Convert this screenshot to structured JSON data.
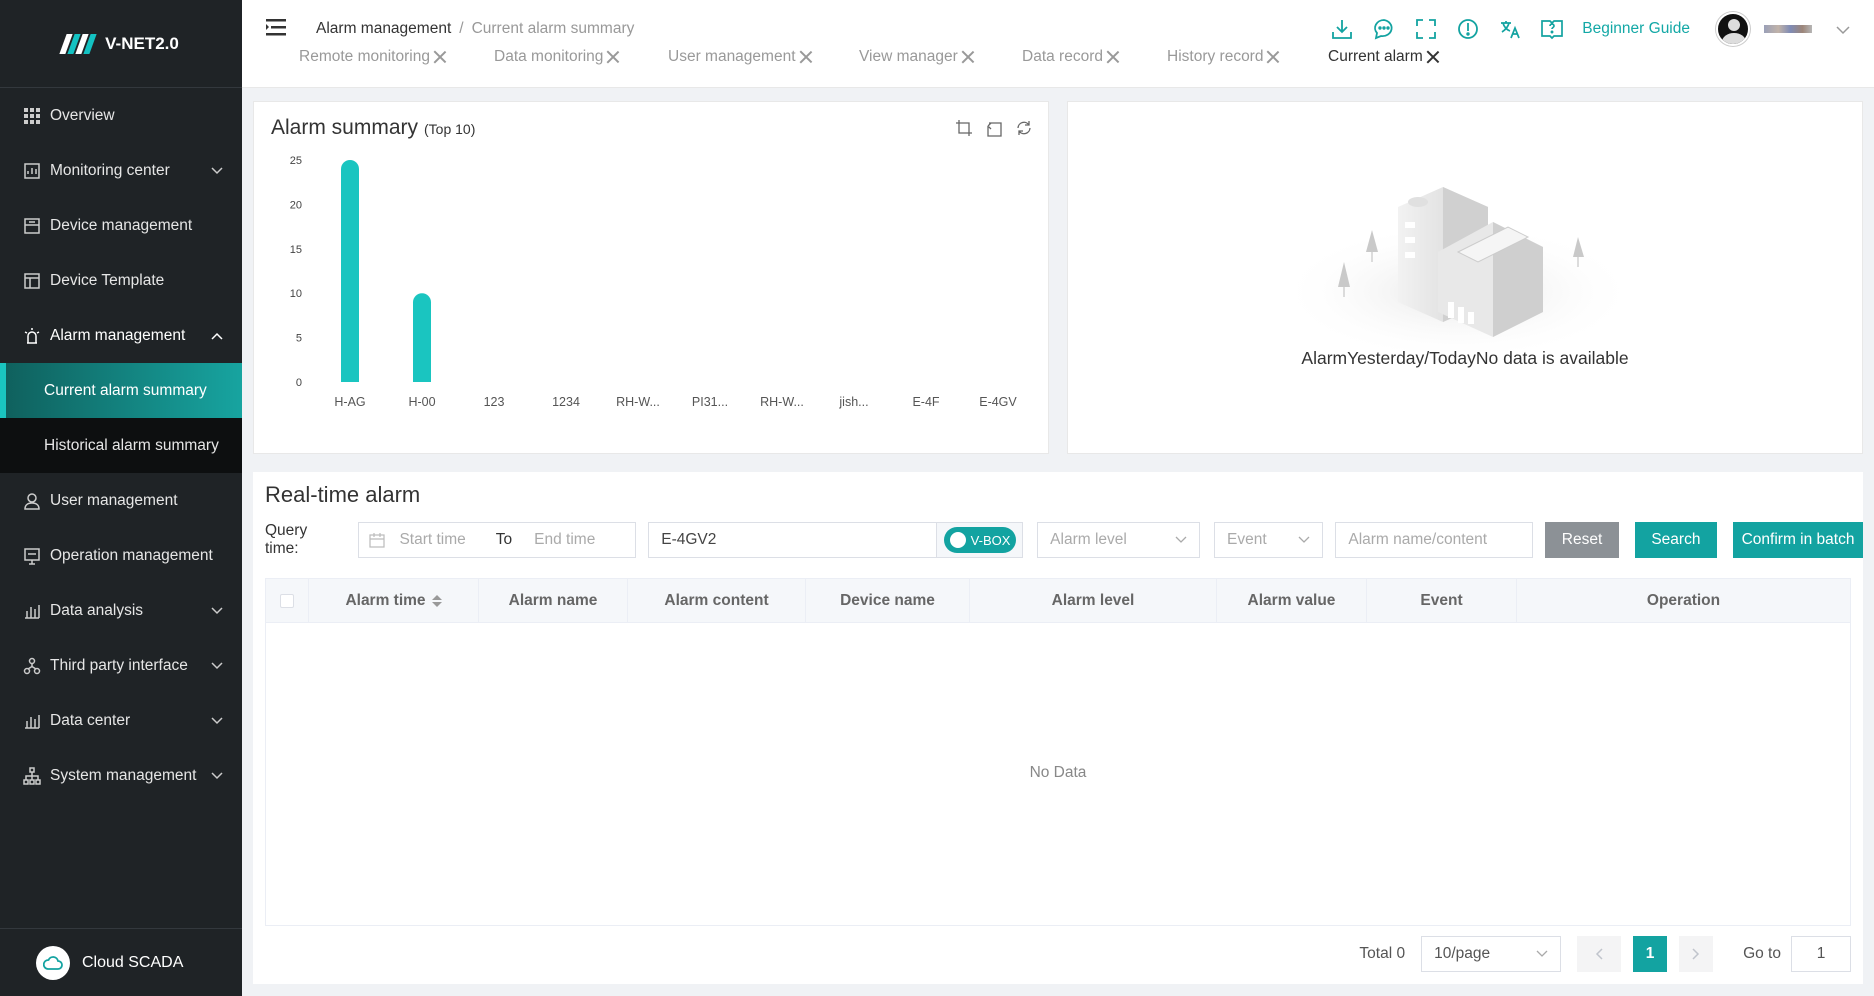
{
  "app": {
    "name": "V-NET2.0",
    "cloud_label": "Cloud SCADA"
  },
  "sidebar": {
    "items": [
      {
        "label": "Overview",
        "icon": "grid-icon",
        "has_chevron": false
      },
      {
        "label": "Monitoring center",
        "icon": "monitor-icon",
        "has_chevron": true
      },
      {
        "label": "Device management",
        "icon": "device-icon",
        "has_chevron": false
      },
      {
        "label": "Device Template",
        "icon": "template-icon",
        "has_chevron": false
      },
      {
        "label": "Alarm management",
        "icon": "alarm-icon",
        "has_chevron": true,
        "expanded": true
      },
      {
        "label": "User management",
        "icon": "user-icon",
        "has_chevron": false
      },
      {
        "label": "Operation management",
        "icon": "operation-icon",
        "has_chevron": false
      },
      {
        "label": "Data analysis",
        "icon": "bar-chart-icon",
        "has_chevron": true
      },
      {
        "label": "Third party interface",
        "icon": "interface-icon",
        "has_chevron": true
      },
      {
        "label": "Data center",
        "icon": "bar-chart-icon",
        "has_chevron": true
      },
      {
        "label": "System management",
        "icon": "hierarchy-icon",
        "has_chevron": true
      }
    ],
    "alarm_sub": [
      "Current alarm summary",
      "Historical alarm summary"
    ],
    "active_sub": "Current alarm summary"
  },
  "header": {
    "breadcrumb": [
      "Alarm management",
      "Current alarm summary"
    ],
    "tabs": [
      "Remote monitoring",
      "Data monitoring",
      "User management",
      "View manager",
      "Data record",
      "History record",
      "Current alarm"
    ],
    "active_tab": "Current alarm",
    "icons": [
      "download-icon",
      "message-icon",
      "fullscreen-icon",
      "info-icon",
      "translate-icon",
      "help-book-icon"
    ],
    "guide_label": "Beginner Guide"
  },
  "summary": {
    "title": "Alarm summary",
    "subtitle": "(Top 10)"
  },
  "chart_data": {
    "type": "bar",
    "categories": [
      "H-AG",
      "H-00",
      "123",
      "1234",
      "RH-W...",
      "PI31...",
      "RH-W...",
      "jish...",
      "E-4F",
      "E-4GV"
    ],
    "values": [
      25,
      10,
      0,
      0,
      0,
      0,
      0,
      0,
      0,
      0
    ],
    "ylim": [
      0,
      25
    ],
    "yticks": [
      0,
      5,
      10,
      15,
      20,
      25
    ],
    "color": "#1ac5c0",
    "grid": false
  },
  "empty_panel": {
    "text": "AlarmYesterday/TodayNo data is available"
  },
  "realtime": {
    "title": "Real-time alarm",
    "query_label": "Query time:",
    "start_placeholder": "Start time",
    "to_label": "To",
    "end_placeholder": "End time",
    "device_value": "E-4GV2",
    "toggle_label": "V-BOX",
    "level_placeholder": "Alarm level",
    "event_placeholder": "Event",
    "name_placeholder": "Alarm name/content",
    "reset_label": "Reset",
    "search_label": "Search",
    "batch_label": "Confirm in batch",
    "columns": [
      "Alarm time",
      "Alarm name",
      "Alarm content",
      "Device name",
      "Alarm level",
      "Alarm value",
      "Event",
      "Operation"
    ],
    "empty_text": "No Data",
    "total_label": "Total 0",
    "page_size": "10/page",
    "current_page": "1",
    "goto_label": "Go to",
    "goto_value": "1"
  },
  "colors": {
    "accent": "#13a3a1",
    "sidebar_bg": "#1f2326"
  }
}
